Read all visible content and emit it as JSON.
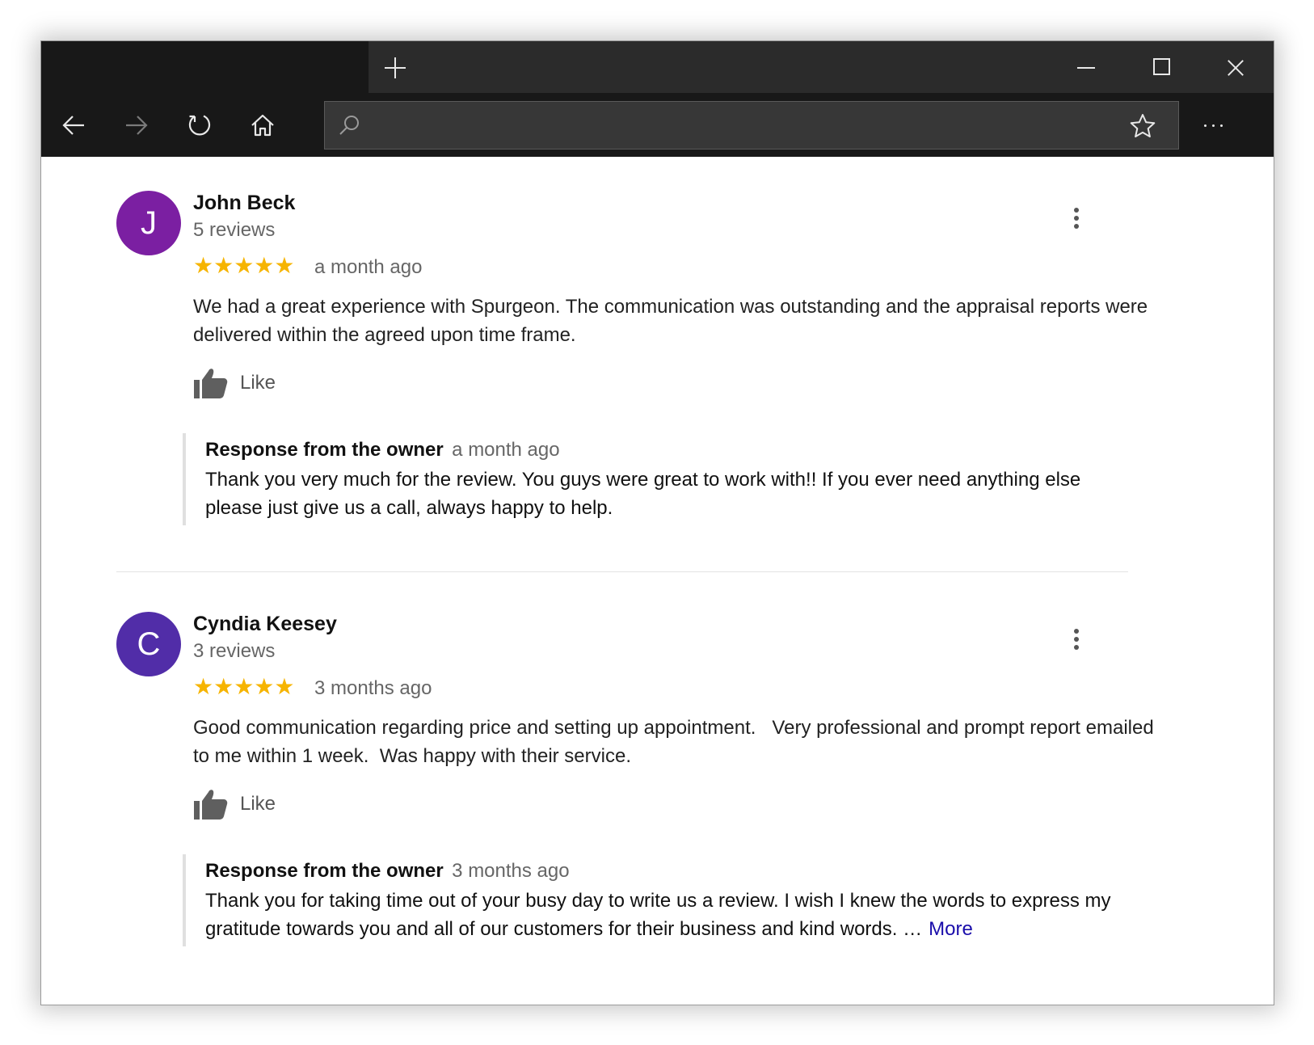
{
  "browser": {
    "address": {
      "value": "",
      "placeholder": ""
    }
  },
  "reviews": [
    {
      "avatar_letter": "J",
      "avatar_color": "#7b1fa2",
      "name": "John Beck",
      "review_count": "5 reviews",
      "stars": "★★★★★",
      "rating": 5,
      "time": "a month ago",
      "text": "We had a great experience with Spurgeon. The communication was outstanding and the appraisal reports were delivered within the agreed upon time frame.",
      "like_label": "Like",
      "response": {
        "title": "Response from the owner",
        "time": "a month ago",
        "text": "Thank you very much for the review. You guys were great to work with!! If you ever need anything else please just give us a call, always happy to help."
      }
    },
    {
      "avatar_letter": "C",
      "avatar_color": "#512da8",
      "name": "Cyndia Keesey",
      "review_count": "3 reviews",
      "stars": "★★★★★",
      "rating": 5,
      "time": "3 months ago",
      "text": "Good communication regarding price and setting up appointment.   Very professional and prompt report emailed to me within 1 week.  Was happy with their service.",
      "like_label": "Like",
      "response": {
        "title": "Response from the owner",
        "time": "3 months ago",
        "text": "Thank you for taking time out of your busy day to write us a review. I wish I knew the words to express my gratitude towards you and all of our customers for their business and kind words. …",
        "more_label": "More"
      }
    }
  ],
  "colors": {
    "star": "#f6b400",
    "link": "#1a0dab",
    "chrome_dark": "#181818",
    "chrome_tab": "#2b2b2b",
    "address_bg": "#373737"
  }
}
